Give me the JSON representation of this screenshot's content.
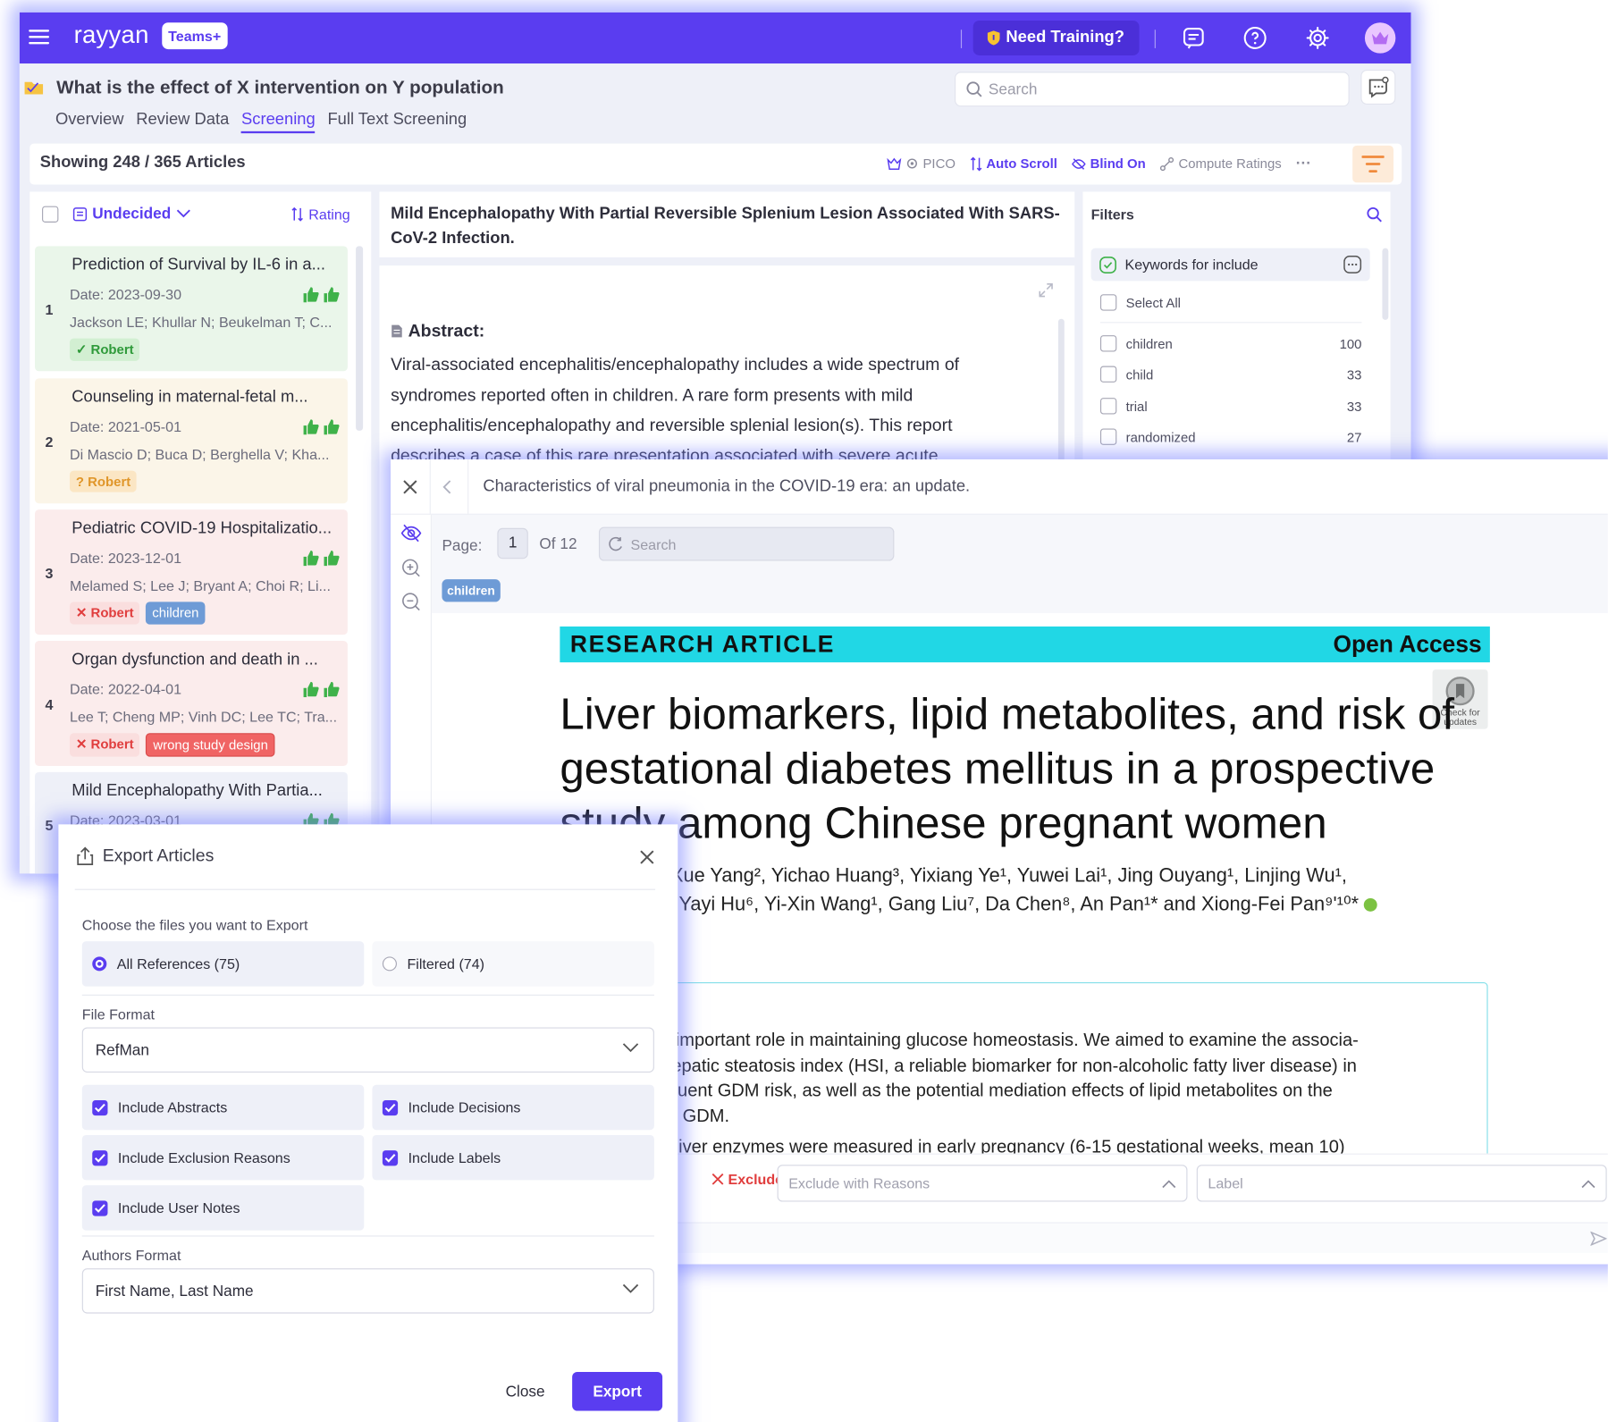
{
  "app": {
    "logo": "rayyan",
    "plan_badge": "Teams+",
    "training_label": "Need Training?",
    "review_title": "What is the effect of X intervention on Y population",
    "tabs": [
      "Overview",
      "Review Data",
      "Screening",
      "Full Text Screening"
    ],
    "active_tab": "Screening",
    "search_placeholder": "Search",
    "accent_color": "#5a3df0"
  },
  "toolbar": {
    "showing": "Showing 248 / 365 Articles",
    "pico": "PICO",
    "auto_scroll": "Auto Scroll",
    "blind_on": "Blind On",
    "compute_ratings": "Compute Ratings",
    "more": "···"
  },
  "list": {
    "filter_label": "Undecided",
    "sort_label": "Rating",
    "articles": [
      {
        "num": "1",
        "title": "Prediction of Survival by IL-6 in a...",
        "date": "Date: 2023-09-30",
        "authors": "Jackson LE; Khullar N; Beukelman T; C...",
        "decision": "Robert",
        "decision_type": "include",
        "labels": []
      },
      {
        "num": "2",
        "title": "Counseling in maternal-fetal m...",
        "date": "Date: 2021-05-01",
        "authors": "Di Mascio D; Buca D; Berghella V; Kha...",
        "decision": "Robert",
        "decision_type": "maybe",
        "labels": []
      },
      {
        "num": "3",
        "title": "Pediatric COVID-19 Hospitalizatio...",
        "date": "Date: 2023-12-01",
        "authors": "Melamed S; Lee J; Bryant A; Choi R; Li...",
        "decision": "Robert",
        "decision_type": "exclude",
        "labels": [
          "children"
        ]
      },
      {
        "num": "4",
        "title": "Organ dysfunction and death in ...",
        "date": "Date: 2022-04-01",
        "authors": "Lee T; Cheng MP; Vinh DC; Lee TC; Tra...",
        "decision": "Robert",
        "decision_type": "exclude",
        "labels": [
          "wrong study design"
        ]
      },
      {
        "num": "5",
        "title": "Mild Encephalopathy With Partia...",
        "date": "Date: 2023-03-01",
        "authors": "",
        "decision": "",
        "decision_type": "none",
        "labels": []
      }
    ]
  },
  "article": {
    "title": "Mild Encephalopathy With Partial Reversible Splenium Lesion Associated With SARS-CoV-2 Infection.",
    "abstract_heading": "Abstract:",
    "abstract": "Viral-associated encephalitis/encephalopathy includes a wide spectrum of syndromes reported often in children. A rare form presents with mild encephalitis/encephalopathy and reversible splenial lesion(s). This report describes a case of this rare presentation associated with severe acute"
  },
  "filters": {
    "heading": "Filters",
    "group": "Keywords for include",
    "select_all": "Select All",
    "keywords": [
      {
        "name": "children",
        "count": "100"
      },
      {
        "name": "child",
        "count": "33"
      },
      {
        "name": "trial",
        "count": "33"
      },
      {
        "name": "randomized",
        "count": "27"
      }
    ]
  },
  "pdf": {
    "doc_title": "Characteristics of viral pneumonia in the COVID-19 era: an update.",
    "page_label": "Page:",
    "page_num": "1",
    "page_of": "Of 12",
    "search_placeholder": "Search",
    "label_chip": "children",
    "banner_left": "RESEARCH ARTICLE",
    "banner_right": "Open Access",
    "check_updates": "Check for updates",
    "paper_title": "Liver biomarkers, lipid metabolites, and risk of gestational diabetes mellitus in a prospective study among Chinese pregnant women",
    "authors_line1": "ang¹, Yi Ye¹, Xue Yang², Yichao Huang³, Yixiang Ye¹, Yuwei Lai¹, Jing Ouyang¹, Linjing Wu¹,",
    "authors_line2": "iaying Yuan⁵, Yayi Hu⁶, Yi-Xin Wang¹, Gang Liu⁷, Da Chen⁸, An Pan¹* and Xiong-Fei Pan⁹ʹ¹⁰*",
    "abstract_lines": [
      "Liver plays an important  role in maintaining glucose homeostasis. We aimed to examine the associa-",
      "nzymes and hepatic steatosis index (HSI, a reliable biomarker for non-alcoholic fatty liver disease) in",
      "cy with subsequent GDM risk, as well as the potential mediation effects of lipid metabolites on the",
      "tween HSI and GDM.",
      "a birth cohort, liver enzymes were measured in early pregnancy (6-15 gestational weeks, mean 10)"
    ],
    "exclude": "Exclude",
    "exclude_reasons": "Exclude with Reasons",
    "label_placeholder": "Label"
  },
  "export": {
    "title": "Export Articles",
    "choose_label": "Choose the files you want to Export",
    "all_refs": "All References (75)",
    "filtered": "Filtered (74)",
    "file_format_label": "File Format",
    "file_format": "RefMan",
    "include_abstracts": "Include Abstracts",
    "include_decisions": "Include Decisions",
    "include_exclusion": "Include Exclusion Reasons",
    "include_labels": "Include Labels",
    "include_notes": "Include User Notes",
    "authors_format_label": "Authors Format",
    "authors_format": "First Name, Last Name",
    "close": "Close",
    "export": "Export"
  }
}
